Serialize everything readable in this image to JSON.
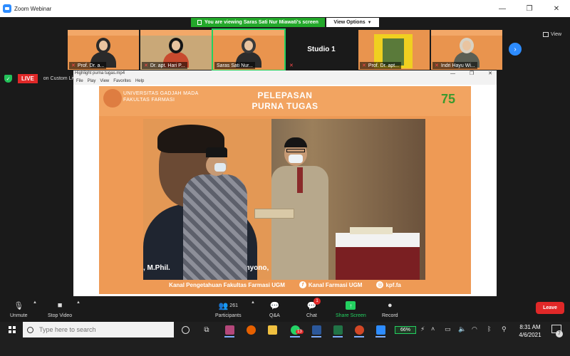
{
  "window": {
    "title": "Zoom Webinar"
  },
  "banner": {
    "viewing": "You are viewing Saras Sati Nur Miawati's screen",
    "view_options": "View Options"
  },
  "gallery": {
    "tiles": [
      {
        "name": "Prof. Dr. a..."
      },
      {
        "name": "Dr. apt. Hari P..."
      },
      {
        "name": "Saras Sati Nur..."
      },
      {
        "name": "Studio 1"
      },
      {
        "name": "Prof. Dr. apt..."
      },
      {
        "name": "Indri Hayu Wi..."
      }
    ],
    "view_label": "View"
  },
  "live": {
    "badge": "LIVE",
    "text": "on Custom Live Streaming Service"
  },
  "player": {
    "title": "Highlight purna tugas.mp4",
    "menu": [
      "File",
      "Play",
      "View",
      "Favorites",
      "Help"
    ]
  },
  "video": {
    "institution": [
      "UNIVERSITAS GADJAH MADA",
      "FAKULTAS FARMASI"
    ],
    "event_title": [
      "PELEPASAN",
      "PURNA TUGAS"
    ],
    "anniversary": "75",
    "poster_caption_left": ", M.Phil.",
    "poster_caption_right": "o Wahyono, S",
    "footer": {
      "channel": "Kanal Pengetahuan Fakultas Farmasi UGM",
      "facebook": "Kanal Farmasi UGM",
      "instagram": "kpf.fa"
    }
  },
  "toolbar": {
    "unmute": "Unmute",
    "stop_video": "Stop Video",
    "participants": "Participants",
    "participants_count": "261",
    "qa": "Q&A",
    "chat": "Chat",
    "chat_badge": "1",
    "share_screen": "Share Screen",
    "record": "Record",
    "leave": "Leave"
  },
  "taskbar": {
    "search_placeholder": "Type here to search",
    "battery": "66%",
    "time": "8:31 AM",
    "date": "4/6/2021",
    "notif_count": "7",
    "whatsapp_badge": "13"
  },
  "colors": {
    "accent": "#2d8cff",
    "share_green": "#23d160",
    "leave_red": "#e02828",
    "video_orange": "#ee9a55"
  }
}
